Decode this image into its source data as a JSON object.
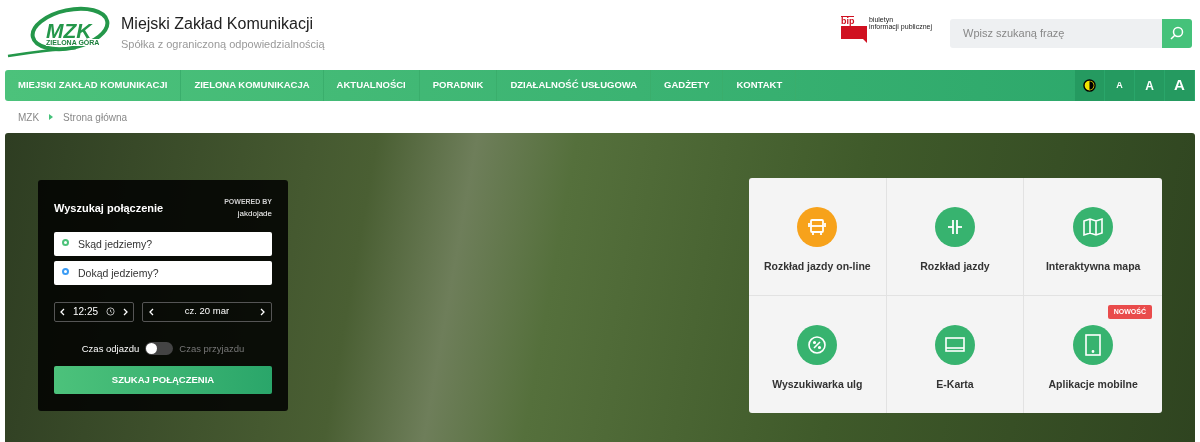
{
  "header": {
    "logo_text": "MZK",
    "logo_subtext": "ZIELONA GÓRA",
    "title": "Miejski Zakład Komunikacji",
    "subtitle": "Spółka z ograniczoną odpowiedzialnością",
    "bip": {
      "mark": "bip",
      "line_1": "biuletyn",
      "line_2": "informacji publicznej"
    },
    "search": {
      "placeholder": "Wpisz szukaną frazę"
    }
  },
  "nav": {
    "items": [
      {
        "label": "MIEJSKI ZAKŁAD KOMUNIKACJI"
      },
      {
        "label": "ZIELONA KOMUNIKACJA"
      },
      {
        "label": "AKTUALNOŚCI"
      },
      {
        "label": "PORADNIK"
      },
      {
        "label": "DZIAŁALNOŚĆ USŁUGOWA"
      },
      {
        "label": "GADŻETY"
      },
      {
        "label": "KONTAKT"
      }
    ],
    "font_sizes": [
      {
        "label": "A",
        "kind": "small"
      },
      {
        "label": "A",
        "kind": "medium"
      },
      {
        "label": "A",
        "kind": "large"
      }
    ]
  },
  "breadcrumb": [
    "MZK",
    "Strona główna"
  ],
  "planner": {
    "title": "Wyszukaj połączenie",
    "powered_by": "POWERED BY",
    "provider": "jakdojade",
    "from": {
      "placeholder": "Skąd jedziemy?",
      "color": "#4cc27a"
    },
    "to": {
      "placeholder": "Dokąd jedziemy?",
      "color": "#3b9cf5"
    },
    "time": "12:25",
    "date": "cz. 20 mar",
    "departure_label": "Czas odjazdu",
    "arrival_label": "Czas przyjazdu",
    "arrival_mode": false,
    "button": "SZUKAJ POŁĄCZENIA"
  },
  "tiles": [
    {
      "label": "Rozkład jazdy on-line",
      "kind": "bus",
      "color": "#f7a21b"
    },
    {
      "label": "Rozkład jazdy",
      "kind": "stop",
      "color": "#37b36f"
    },
    {
      "label": "Interaktywna mapa",
      "kind": "map",
      "color": "#37b36f"
    },
    {
      "label": "Wyszukiwarka ulg",
      "kind": "discount",
      "color": "#37b36f"
    },
    {
      "label": "E-Karta",
      "kind": "card",
      "color": "#37b36f"
    },
    {
      "label": "Aplikacje mobilne",
      "kind": "phone",
      "color": "#37b36f",
      "badge": "NOWOŚĆ"
    }
  ]
}
